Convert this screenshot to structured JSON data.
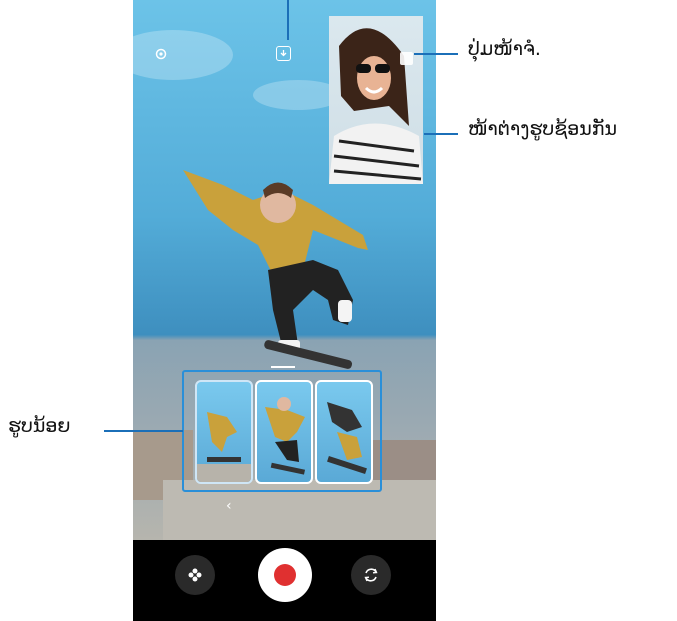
{
  "callouts": {
    "switch_label": "ປຸ່ມໜ້າຈໍ.",
    "pip_label": "ໜ້າຕ່າງຮູບຊ້ອນກັນ",
    "thumbnail_label": "ຮູບນ້ອຍ"
  },
  "icons": {
    "settings": "gear-icon",
    "download": "download-icon",
    "effects": "flower-icon",
    "switch_camera": "switch-camera-icon",
    "back": "chevron-left-icon"
  },
  "colors": {
    "callout_line": "#1b6fb8",
    "record_dot": "#e03030",
    "strip_border": "#2a8fd8"
  },
  "glyphs": {
    "chevron": "‹"
  }
}
